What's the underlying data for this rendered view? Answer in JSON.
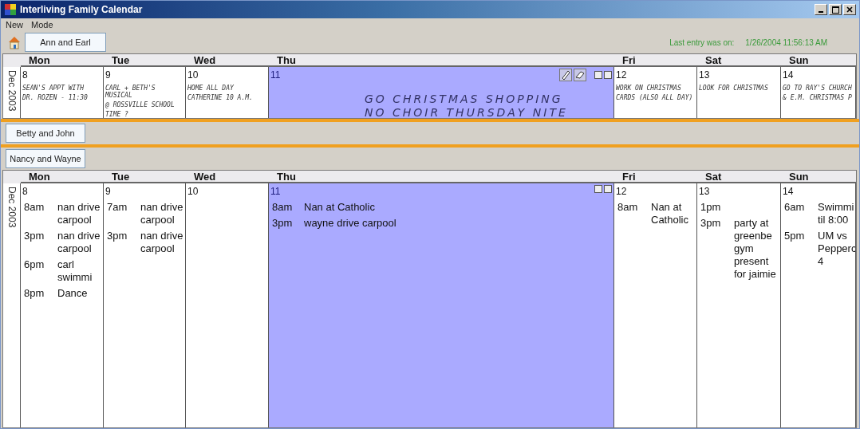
{
  "window": {
    "title": "Interliving Family Calendar"
  },
  "menu": [
    "New",
    "Mode"
  ],
  "last_entry": {
    "label": "Last entry was on:",
    "value": "1/26/2004 11:56:13 AM"
  },
  "panels": [
    {
      "member": "Ann and Earl",
      "expanded": true,
      "kind": "ink",
      "month_label": "Dec 2003",
      "days": [
        {
          "weekday": "Mon",
          "date": "8",
          "selected": false,
          "notes": [
            "SEAN'S APPT WITH",
            "DR. ROZEN - 11:30"
          ]
        },
        {
          "weekday": "Tue",
          "date": "9",
          "selected": false,
          "notes": [
            "CARL + BETH'S MUSICAL",
            "@ ROSSVILLE SCHOOL",
            "TIME ?"
          ]
        },
        {
          "weekday": "Wed",
          "date": "10",
          "selected": false,
          "notes": [
            "HOME ALL DAY",
            "CATHERINE 10 A.M."
          ]
        },
        {
          "weekday": "Thu",
          "date": "11",
          "selected": true,
          "notes": [
            "GO CHRISTMAS SHOPPING",
            "NO CHOIR THURSDAY NITE"
          ]
        },
        {
          "weekday": "Fri",
          "date": "12",
          "selected": false,
          "notes": [
            "WORK ON CHRISTMAS",
            "CARDS (ALSO ALL DAY)"
          ]
        },
        {
          "weekday": "Sat",
          "date": "13",
          "selected": false,
          "notes": [
            "LOOK FOR CHRISTMAS"
          ]
        },
        {
          "weekday": "Sun",
          "date": "14",
          "selected": false,
          "notes": [
            "GO TO RAY'S CHURCH",
            "& E.M. CHRISTMAS P"
          ]
        }
      ]
    },
    {
      "member": "Betty and John",
      "expanded": false
    },
    {
      "member": "Nancy and Wayne",
      "expanded": true,
      "kind": "typed",
      "month_label": "Dec 2003",
      "days": [
        {
          "weekday": "Mon",
          "date": "8",
          "selected": false,
          "events": [
            {
              "time": "8am",
              "text": "nan drive carpool"
            },
            {
              "time": "3pm",
              "text": "nan drive carpool"
            },
            {
              "time": "6pm",
              "text": "carl swimmi"
            },
            {
              "time": "8pm",
              "text": "Dance"
            }
          ]
        },
        {
          "weekday": "Tue",
          "date": "9",
          "selected": false,
          "events": [
            {
              "time": "7am",
              "text": "nan drive carpool"
            },
            {
              "time": "3pm",
              "text": "nan drive carpool"
            }
          ]
        },
        {
          "weekday": "Wed",
          "date": "10",
          "selected": false
        },
        {
          "weekday": "Thu",
          "date": "11",
          "selected": true,
          "events": [
            {
              "time": "8am",
              "text": "Nan at Catholic"
            },
            {
              "time": "3pm",
              "text": "wayne drive carpool"
            }
          ]
        },
        {
          "weekday": "Fri",
          "date": "12",
          "selected": false,
          "events": [
            {
              "time": "8am",
              "text": "Nan at Catholic"
            }
          ]
        },
        {
          "weekday": "Sat",
          "date": "13",
          "selected": false,
          "events": [
            {
              "time": "1pm"
            },
            {
              "time": "3pm",
              "text": "party at greenbe gym present for jaimie"
            }
          ]
        },
        {
          "weekday": "Sun",
          "date": "14",
          "selected": false,
          "events": [
            {
              "time": "6am",
              "text": "Swimmi til 8:00"
            },
            {
              "time": "5pm",
              "text": "UM vs Pepperc 4"
            }
          ]
        }
      ]
    }
  ]
}
